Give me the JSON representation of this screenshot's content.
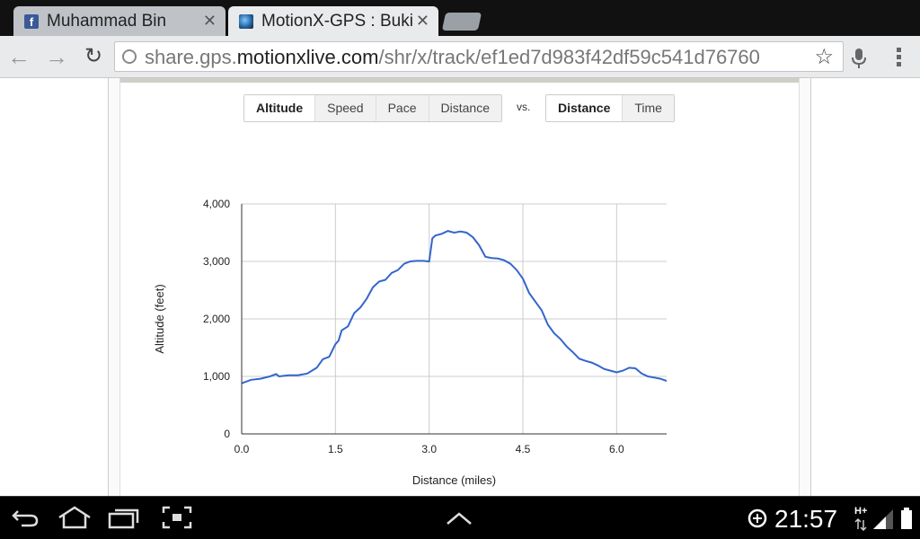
{
  "tabs": [
    {
      "title": "Muhammad Bin",
      "icon": "facebook-icon",
      "close": "✕"
    },
    {
      "title": "MotionX-GPS : Bukit",
      "icon": "motionx-icon",
      "close": "✕"
    }
  ],
  "toolbar": {
    "url_prefix": "share.gps.",
    "url_host": "motionxlive.com",
    "url_path": "/shr/x/track/ef1ed7d983f42df59c541d76760"
  },
  "controls": {
    "metrics": [
      "Altitude",
      "Speed",
      "Pace",
      "Distance"
    ],
    "active_metric": "Altitude",
    "vs": "vs.",
    "basis": [
      "Distance",
      "Time"
    ],
    "active_basis": "Distance"
  },
  "chart_data": {
    "type": "line",
    "xlabel": "Distance (miles)",
    "ylabel": "Altitude (feet)",
    "xlim": [
      0,
      6.8
    ],
    "ylim": [
      0,
      4000
    ],
    "xticks": [
      "0.0",
      "1.5",
      "3.0",
      "4.5",
      "6.0"
    ],
    "xtick_values": [
      0,
      1.5,
      3.0,
      4.5,
      6.0
    ],
    "yticks": [
      "0",
      "1,000",
      "2,000",
      "3,000",
      "4,000"
    ],
    "ytick_values": [
      0,
      1000,
      2000,
      3000,
      4000
    ],
    "grid": true,
    "color": "#3366cc",
    "series": [
      {
        "x": [
          0,
          0.15,
          0.3,
          0.45,
          0.55,
          0.6,
          0.75,
          0.9,
          1.05,
          1.2,
          1.3,
          1.4,
          1.5,
          1.55,
          1.6,
          1.7,
          1.8,
          1.85,
          1.9,
          2.0,
          2.1,
          2.2,
          2.3,
          2.4,
          2.5,
          2.6,
          2.7,
          2.8,
          2.9,
          3.0,
          3.05,
          3.1,
          3.2,
          3.3,
          3.4,
          3.5,
          3.6,
          3.7,
          3.8,
          3.9,
          4.0,
          4.1,
          4.2,
          4.3,
          4.4,
          4.5,
          4.6,
          4.7,
          4.8,
          4.9,
          5.0,
          5.1,
          5.2,
          5.3,
          5.4,
          5.5,
          5.6,
          5.7,
          5.8,
          5.9,
          6.0,
          6.1,
          6.2,
          6.3,
          6.4,
          6.5,
          6.6,
          6.7,
          6.8
        ],
        "y": [
          880,
          940,
          960,
          1000,
          1040,
          1000,
          1020,
          1020,
          1050,
          1150,
          1300,
          1340,
          1560,
          1620,
          1800,
          1870,
          2100,
          2150,
          2200,
          2350,
          2550,
          2650,
          2680,
          2800,
          2850,
          2960,
          3000,
          3010,
          3010,
          3000,
          3400,
          3450,
          3480,
          3530,
          3500,
          3520,
          3500,
          3420,
          3280,
          3080,
          3060,
          3050,
          3020,
          2960,
          2850,
          2700,
          2450,
          2300,
          2150,
          1900,
          1750,
          1650,
          1520,
          1420,
          1310,
          1270,
          1240,
          1190,
          1130,
          1100,
          1070,
          1100,
          1150,
          1140,
          1050,
          1000,
          980,
          960,
          920
        ]
      }
    ]
  },
  "navbar": {
    "time": "21:57",
    "network": "H+"
  }
}
